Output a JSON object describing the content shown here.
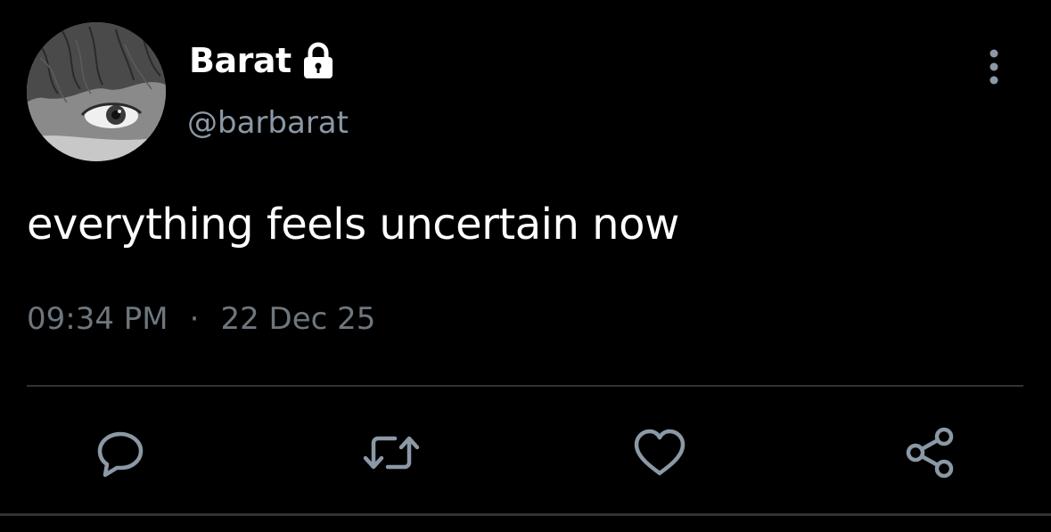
{
  "tweet": {
    "display_name": "Barat",
    "handle": "@barbarat",
    "text": "everything feels uncertain now",
    "time": "09:34 PM",
    "separator": "·",
    "date": "22 Dec 25",
    "protected_icon": "lock-icon",
    "menu_icon": "more-vertical-icon"
  },
  "actions": [
    {
      "name": "reply",
      "icon": "reply-icon"
    },
    {
      "name": "retweet",
      "icon": "retweet-icon"
    },
    {
      "name": "like",
      "icon": "heart-icon"
    },
    {
      "name": "share",
      "icon": "share-icon"
    }
  ],
  "colors": {
    "background": "#000000",
    "primary_text": "#ffffff",
    "secondary_text": "#8b98a5",
    "icon": "#8b98a5",
    "divider": "#2f3336"
  }
}
